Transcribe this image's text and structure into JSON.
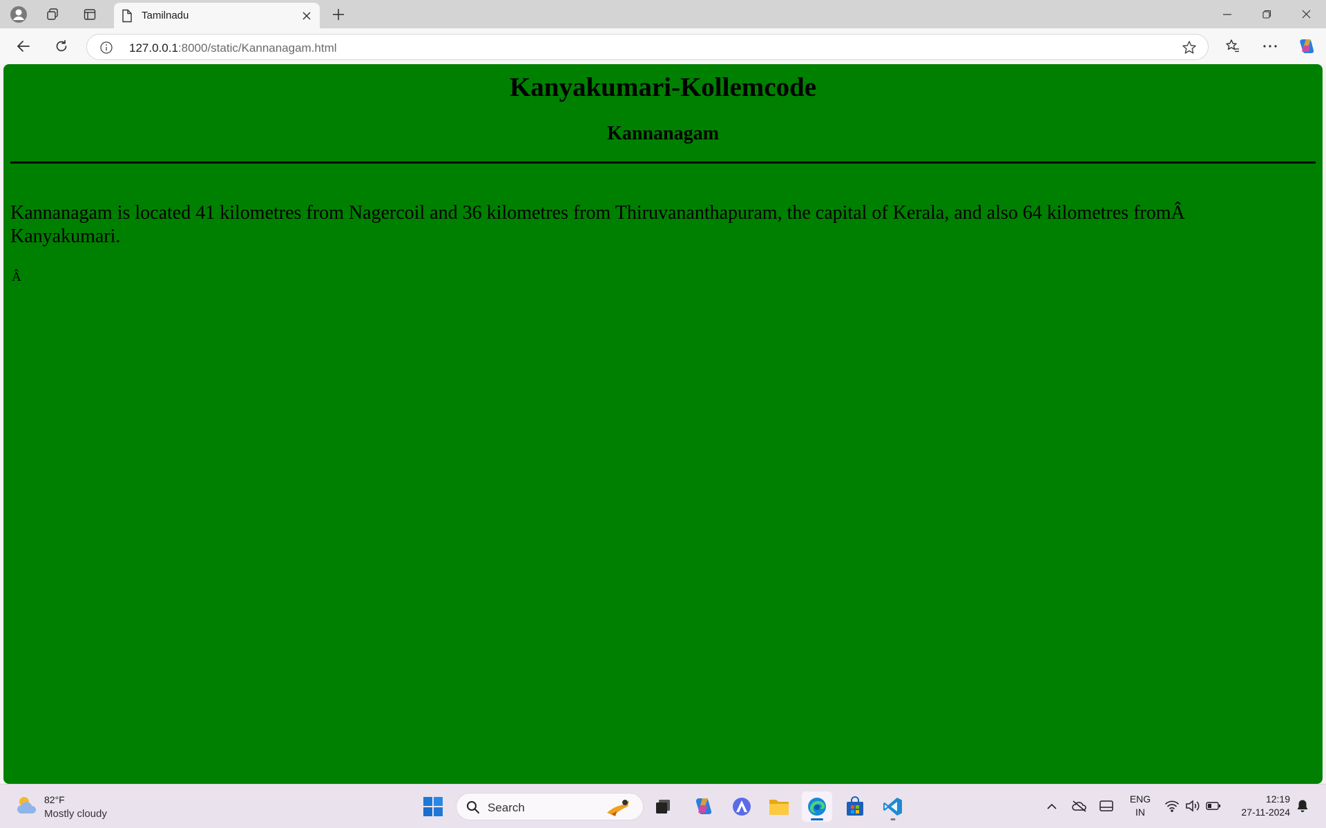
{
  "browser": {
    "tab": {
      "title": "Tamilnadu"
    },
    "address": {
      "host": "127.0.0.1",
      "path": ":8000/static/Kannanagam.html"
    }
  },
  "page": {
    "heading": "Kanyakumari-Kollemcode",
    "subheading": "Kannanagam",
    "paragraph": "Kannanagam is located 41 kilometres from Nagercoil and 36 kilometres from Thiruvananthapuram, the capital of Kerala, and also 64 kilometres fromÂ Kanyakumari.",
    "stray_char": "Â",
    "background_color": "#008000"
  },
  "taskbar": {
    "weather": {
      "temp": "82°F",
      "desc": "Mostly cloudy"
    },
    "search_placeholder": "Search",
    "lang_line1": "ENG",
    "lang_line2": "IN",
    "time": "12:19",
    "date": "27-11-2024"
  },
  "icons": {
    "tab_strip": [
      "profile-icon",
      "workspaces-icon",
      "vertical-tabs-icon",
      "page-icon",
      "close-icon",
      "new-tab-icon",
      "minimize-icon",
      "restore-icon",
      "window-close-icon"
    ],
    "toolbar": [
      "back-icon",
      "refresh-icon",
      "info-icon",
      "favorite-star-icon",
      "favorites-icon",
      "more-icon",
      "copilot-icon"
    ],
    "taskbar": [
      "weather-icon",
      "start-icon",
      "search-icon",
      "task-view-icon",
      "copilot-icon",
      "app-icon",
      "file-explorer-icon",
      "edge-icon",
      "store-icon",
      "vscode-icon",
      "chevron-up-icon",
      "onedrive-icon",
      "tablet-icon",
      "wifi-icon",
      "volume-icon",
      "battery-icon",
      "notification-bell-icon"
    ]
  }
}
